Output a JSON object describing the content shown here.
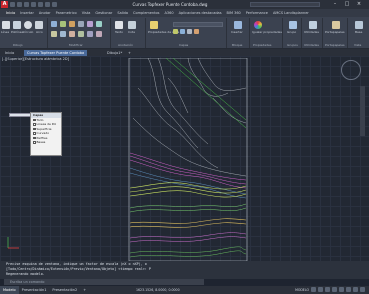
{
  "window": {
    "title": "Curvas Topfexer Puente Cordoba.dwg",
    "search_placeholder": "Escriba palabra clave o frase",
    "controls": [
      "minimize-icon",
      "maximize-icon",
      "close-icon"
    ]
  },
  "app_logo": "A",
  "menu_tabs": [
    "Inicio",
    "Insertar",
    "Anotar",
    "Parametrico",
    "Vista",
    "Gestionar",
    "Salida",
    "Complementos",
    "A360",
    "Aplicaciones destacadas",
    "BIM 360",
    "Performance",
    "AMCS Landisplanner"
  ],
  "active_menu_tab": 0,
  "ribbon": {
    "groups": [
      {
        "label": "Dibujo",
        "buttons": [
          "Línea",
          "Polilínea",
          "Círculo",
          "Arco"
        ]
      },
      {
        "label": "Modificar",
        "buttons": []
      },
      {
        "label": "Anotación",
        "buttons": [
          "Texto",
          "Cota"
        ]
      },
      {
        "label": "Capas",
        "buttons": [
          "Propiedades de capa"
        ]
      },
      {
        "label": "Bloque",
        "buttons": [
          "Insertar"
        ]
      },
      {
        "label": "Propiedades",
        "buttons": [
          "Igualar propiedades"
        ]
      },
      {
        "label": "Grupos",
        "buttons": [
          "Grupo"
        ]
      },
      {
        "label": "Utilidades",
        "buttons": [
          "Utilidades"
        ]
      },
      {
        "label": "Portapapeles",
        "buttons": [
          "Portapapeles"
        ]
      },
      {
        "label": "Vista",
        "buttons": [
          "Base"
        ]
      }
    ]
  },
  "doc_tabs": [
    "Inicio",
    "Curvas Topfexer Puente Cordoba",
    "Dibujo1*"
  ],
  "active_doc_tab": 1,
  "viewport_label": "[-][Superior][Estructura alámbrica 2D]",
  "layer_palette": {
    "title": "Capas",
    "items": [
      "Todo",
      "Lineas de Pol",
      "Superficie",
      "Curvado",
      "Perfiles",
      "Bases"
    ]
  },
  "command_history": [
    "Precise esquina de ventana, indique un factor de escala (nX o nXP), o",
    "[Todo/Centro/Dinámico/Extensión/Previo/Ventana/Objeto] <tiempo real>: P",
    "Regenerando modelo."
  ],
  "command_placeholder": "Escriba un comando",
  "status_tabs": [
    "Modelo",
    "Presentación1",
    "Presentación2"
  ],
  "active_status_tab": 0,
  "coords": "1623.1526, 8.0000, 0.0000",
  "model_label": "MODELO"
}
